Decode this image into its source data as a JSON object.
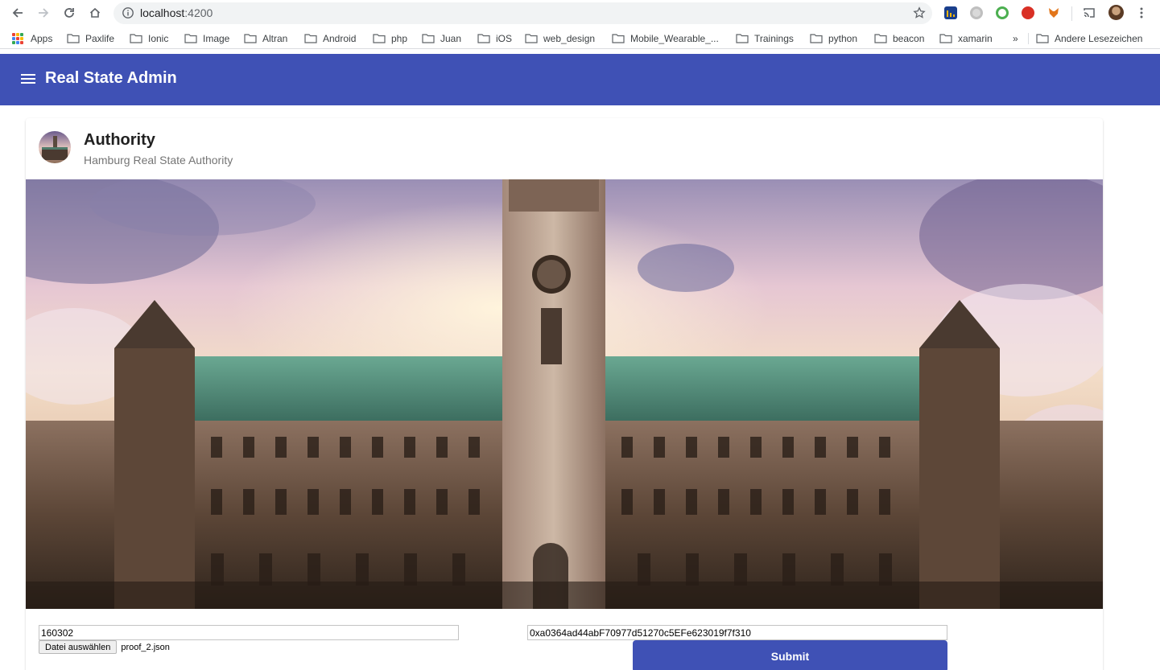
{
  "browser": {
    "url_host": "localhost",
    "url_port": ":4200",
    "bookmarks": [
      {
        "label": "Apps",
        "icon": "apps-grid-icon"
      },
      {
        "label": "Paxlife",
        "icon": "folder-icon"
      },
      {
        "label": "Ionic",
        "icon": "folder-icon"
      },
      {
        "label": "Image",
        "icon": "folder-icon"
      },
      {
        "label": "Altran",
        "icon": "folder-icon"
      },
      {
        "label": "Android",
        "icon": "folder-icon"
      },
      {
        "label": "php",
        "icon": "folder-icon"
      },
      {
        "label": "Juan",
        "icon": "folder-icon"
      },
      {
        "label": "iOS",
        "icon": "folder-icon"
      },
      {
        "label": "web_design",
        "icon": "folder-icon"
      },
      {
        "label": "Mobile_Wearable_...",
        "icon": "folder-icon"
      },
      {
        "label": "Trainings",
        "icon": "folder-icon"
      },
      {
        "label": "python",
        "icon": "folder-icon"
      },
      {
        "label": "beacon",
        "icon": "folder-icon"
      },
      {
        "label": "xamarin",
        "icon": "folder-icon"
      }
    ],
    "overflow_label": "»",
    "other_bookmarks": "Andere Lesezeichen"
  },
  "app": {
    "title": "Real State Admin",
    "brand_color": "#3f51b5"
  },
  "card": {
    "title": "Authority",
    "subtitle": "Hamburg Real State Authority"
  },
  "form": {
    "id_value": "160302",
    "address_value": "0xa0364ad44abF70977d51270c5EFe623019f7f310",
    "file_button_label": "Datei auswählen",
    "file_name": "proof_2.json",
    "submit_label": "Submit"
  }
}
